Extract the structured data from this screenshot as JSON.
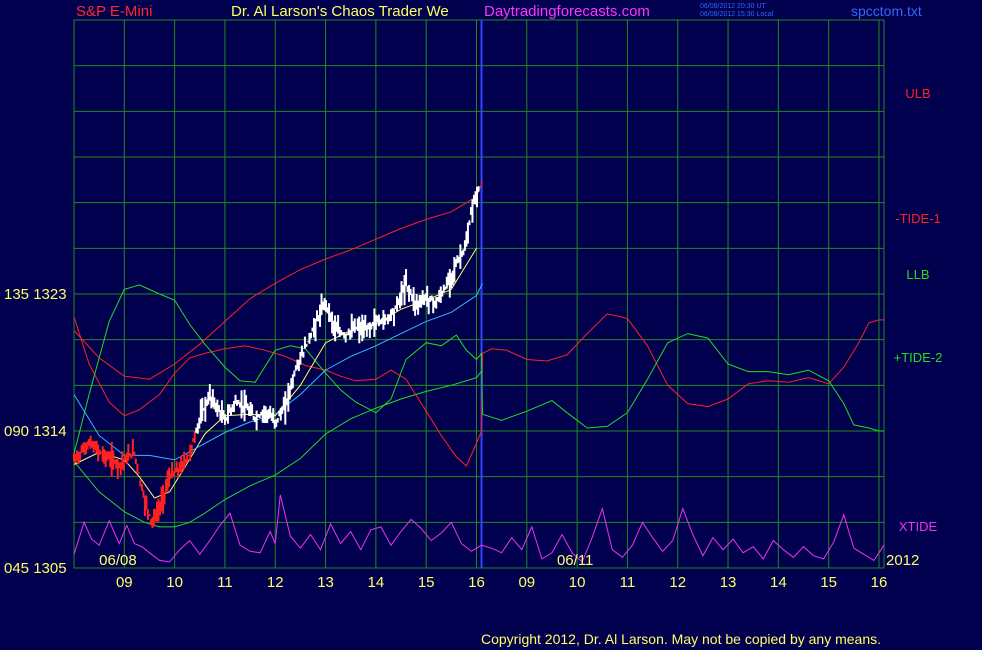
{
  "header": {
    "instrument": "S&P E-Mini",
    "title": "Dr. Al Larson's Chaos Trader We",
    "website": "Daytradingforecasts.com",
    "time_utc": "06/08/2012 20:30 UT",
    "time_local": "06/08/2012 15:30 Local",
    "filename": "spcctom.txt"
  },
  "colors": {
    "background": "#00004e",
    "grid": "#1f8a1f",
    "price": "#ffffff",
    "price_down": "#ff2020",
    "ulb": "#ff2020",
    "tide1": "#ff2020",
    "llb": "#22dd22",
    "tide2": "#22dd22",
    "xtide": "#ee33ee",
    "yellow_ma": "#ffff66",
    "cyan_ma": "#33bbff",
    "divider": "#3344ff",
    "axis_text": "#ffff66"
  },
  "chart_data": {
    "type": "line",
    "title": "S&P E-Mini",
    "y_axis_labels": [
      {
        "code": "135",
        "price": "1323"
      },
      {
        "code": "090",
        "price": "1314"
      },
      {
        "code": "045",
        "price": "1305"
      }
    ],
    "ylim": [
      1305,
      1341
    ],
    "x_day_labels": [
      {
        "label": "06/08",
        "hour": 8.5
      },
      {
        "label": "06/11",
        "hour": 17.6
      }
    ],
    "x_year_label": "2012",
    "x_hour_ticks": [
      "09",
      "10",
      "11",
      "12",
      "13",
      "14",
      "15",
      "16",
      "09",
      "10",
      "11",
      "12",
      "13",
      "14",
      "15",
      "16"
    ],
    "hour_tick_positions": [
      9,
      10,
      11,
      12,
      13,
      14,
      15,
      16,
      17,
      18,
      19,
      20,
      21,
      22,
      23,
      24
    ],
    "xlim": [
      8.0,
      24.1
    ],
    "divider_hour": 16.1,
    "legend": [
      "ULB",
      "-TIDE-1",
      "LLB",
      "+TIDE-2",
      "XTIDE"
    ],
    "series": [
      {
        "name": "Price",
        "color": "#ffffff",
        "x": [
          8.0,
          8.3,
          8.6,
          8.9,
          9.2,
          9.4,
          9.55,
          9.7,
          9.9,
          10.1,
          10.3,
          10.5,
          10.7,
          10.85,
          11.0,
          11.2,
          11.4,
          11.6,
          11.8,
          12.0,
          12.2,
          12.4,
          12.6,
          12.8,
          13.0,
          13.2,
          13.4,
          13.6,
          13.8,
          14.0,
          14.2,
          14.4,
          14.6,
          14.8,
          15.0,
          15.2,
          15.4,
          15.6,
          15.8,
          15.9,
          16.05
        ],
        "y": [
          1312.1,
          1313.2,
          1312.4,
          1311.8,
          1312.6,
          1309.5,
          1308.0,
          1308.9,
          1311.0,
          1311.5,
          1312.5,
          1314.8,
          1316.3,
          1315.5,
          1314.7,
          1315.9,
          1315.6,
          1314.8,
          1315.3,
          1314.6,
          1315.6,
          1318.0,
          1319.5,
          1321.0,
          1322.5,
          1320.6,
          1320.3,
          1320.8,
          1320.6,
          1321.2,
          1321.3,
          1322.1,
          1323.7,
          1322.3,
          1322.8,
          1322.4,
          1323.5,
          1325.0,
          1326.2,
          1328.5,
          1330.0
        ]
      },
      {
        "name": "ULB",
        "color": "#ff2020",
        "x": [
          8.0,
          8.5,
          9.0,
          9.5,
          10.0,
          10.5,
          11.0,
          11.5,
          12.0,
          12.5,
          13.0,
          13.5,
          14.0,
          14.5,
          15.0,
          15.5,
          16.0,
          16.12
        ],
        "y": [
          1320.6,
          1318.8,
          1317.6,
          1317.4,
          1318.4,
          1319.7,
          1321.2,
          1322.7,
          1323.7,
          1324.6,
          1325.3,
          1325.9,
          1326.6,
          1327.3,
          1327.9,
          1328.4,
          1329.4,
          1330.4
        ]
      },
      {
        "name": "LLB",
        "color": "#22dd22",
        "x": [
          8.0,
          8.5,
          9.0,
          9.4,
          9.7,
          10.0,
          10.3,
          10.6,
          11.0,
          11.5,
          12.0,
          12.5,
          13.0,
          13.5,
          14.0,
          14.5,
          15.0,
          15.5,
          16.0,
          16.12
        ],
        "y": [
          1312.0,
          1310.0,
          1308.7,
          1308.0,
          1307.7,
          1307.7,
          1308.0,
          1308.6,
          1309.5,
          1310.4,
          1311.1,
          1312.2,
          1313.8,
          1314.8,
          1315.5,
          1316.1,
          1316.6,
          1317.0,
          1317.5,
          1318.0
        ]
      },
      {
        "name": "-TIDE-1",
        "color": "#ff2020",
        "x": [
          8.0,
          8.3,
          8.7,
          9.0,
          9.3,
          9.7,
          10.0,
          10.3,
          10.6,
          11.0,
          11.4,
          11.8,
          12.2,
          12.6,
          13.0,
          13.3,
          13.6,
          14.0,
          14.3,
          14.6,
          15.0,
          15.3,
          15.6,
          15.8,
          16.0,
          16.1,
          16.12,
          16.3,
          16.6,
          17.0,
          17.4,
          17.8,
          18.2,
          18.6,
          19.0,
          19.4,
          19.8,
          20.2,
          20.6,
          21.0,
          21.4,
          21.8,
          22.2,
          22.6,
          23.0,
          23.3,
          23.6,
          23.8,
          24.0,
          24.1
        ],
        "y": [
          1321.5,
          1318.4,
          1315.9,
          1315.0,
          1315.4,
          1316.4,
          1317.8,
          1318.8,
          1319.1,
          1319.4,
          1319.6,
          1319.3,
          1318.9,
          1318.3,
          1318.0,
          1317.6,
          1317.3,
          1317.4,
          1318.0,
          1317.4,
          1315.3,
          1313.7,
          1312.3,
          1311.7,
          1313.2,
          1314.0,
          1319.1,
          1319.4,
          1319.3,
          1318.7,
          1318.6,
          1319.0,
          1320.4,
          1321.7,
          1321.4,
          1319.6,
          1317.0,
          1315.8,
          1315.6,
          1316.1,
          1317.1,
          1317.3,
          1317.2,
          1317.5,
          1317.1,
          1318.2,
          1319.8,
          1321.1,
          1321.3,
          1321.3
        ]
      },
      {
        "name": "+TIDE-2",
        "color": "#22dd22",
        "x": [
          8.0,
          8.3,
          8.7,
          9.0,
          9.3,
          9.7,
          10.0,
          10.3,
          10.6,
          11.0,
          11.3,
          11.6,
          12.0,
          12.3,
          12.6,
          13.0,
          13.3,
          13.6,
          14.0,
          14.3,
          14.6,
          15.0,
          15.3,
          15.6,
          15.8,
          16.0,
          16.1,
          16.12,
          16.5,
          17.0,
          17.5,
          17.8,
          18.2,
          18.6,
          19.0,
          19.4,
          19.8,
          20.2,
          20.6,
          21.0,
          21.4,
          21.8,
          22.2,
          22.6,
          23.0,
          23.3,
          23.5,
          23.8,
          24.0,
          24.1
        ],
        "y": [
          1312.5,
          1316.4,
          1321.2,
          1323.3,
          1323.6,
          1323.0,
          1322.6,
          1321.0,
          1319.7,
          1318.2,
          1317.3,
          1317.2,
          1319.3,
          1319.6,
          1319.4,
          1317.8,
          1316.7,
          1315.9,
          1315.2,
          1316.1,
          1318.7,
          1319.8,
          1319.6,
          1320.3,
          1319.3,
          1318.7,
          1319.1,
          1315.1,
          1314.7,
          1315.3,
          1316.0,
          1315.2,
          1314.2,
          1314.3,
          1315.2,
          1317.4,
          1319.8,
          1320.4,
          1320.1,
          1318.4,
          1317.9,
          1317.9,
          1317.7,
          1318.0,
          1317.3,
          1315.8,
          1314.4,
          1314.2,
          1314.0,
          1314.0
        ]
      },
      {
        "name": "XTIDE",
        "color": "#ee33ee",
        "x": [
          8.0,
          8.2,
          8.35,
          8.5,
          8.7,
          8.9,
          9.05,
          9.2,
          9.35,
          9.5,
          9.7,
          9.9,
          10.1,
          10.3,
          10.5,
          10.7,
          10.9,
          11.1,
          11.3,
          11.5,
          11.7,
          11.9,
          12.0,
          12.1,
          12.3,
          12.5,
          12.7,
          12.9,
          13.1,
          13.3,
          13.5,
          13.7,
          13.9,
          14.1,
          14.3,
          14.5,
          14.7,
          14.9,
          15.1,
          15.3,
          15.5,
          15.7,
          15.9,
          16.1,
          16.3,
          16.5,
          16.7,
          16.9,
          17.1,
          17.3,
          17.5,
          17.7,
          17.9,
          18.1,
          18.3,
          18.5,
          18.7,
          18.9,
          19.1,
          19.3,
          19.5,
          19.7,
          19.9,
          20.1,
          20.3,
          20.5,
          20.7,
          20.9,
          21.1,
          21.3,
          21.5,
          21.7,
          21.9,
          22.1,
          22.3,
          22.5,
          22.7,
          22.9,
          23.1,
          23.3,
          23.5,
          23.7,
          23.9,
          24.1
        ],
        "y": [
          1305.9,
          1308.0,
          1306.9,
          1306.5,
          1308.1,
          1306.6,
          1307.8,
          1306.6,
          1306.4,
          1306.0,
          1305.5,
          1305.4,
          1306.2,
          1306.8,
          1305.9,
          1306.8,
          1307.8,
          1308.6,
          1306.5,
          1306.1,
          1306.0,
          1307.4,
          1306.6,
          1309.8,
          1307.1,
          1306.3,
          1307.2,
          1306.2,
          1307.9,
          1306.6,
          1307.4,
          1306.2,
          1307.5,
          1307.7,
          1306.5,
          1307.4,
          1308.2,
          1307.6,
          1306.8,
          1307.3,
          1308.0,
          1306.6,
          1306.1,
          1306.5,
          1306.3,
          1306.0,
          1307.0,
          1306.2,
          1307.7,
          1305.6,
          1306.0,
          1307.2,
          1306.0,
          1305.4,
          1307.0,
          1308.9,
          1306.2,
          1305.7,
          1306.5,
          1308.0,
          1307.0,
          1306.1,
          1306.8,
          1308.9,
          1307.2,
          1305.8,
          1307.0,
          1306.2,
          1306.9,
          1306.0,
          1306.4,
          1305.6,
          1306.8,
          1306.2,
          1305.7,
          1306.4,
          1305.8,
          1305.6,
          1306.7,
          1308.5,
          1306.3,
          1305.9,
          1305.5,
          1306.5
        ]
      },
      {
        "name": "MA fast",
        "color": "#ffff66",
        "x": [
          8.0,
          8.5,
          9.0,
          9.3,
          9.6,
          9.9,
          10.2,
          10.6,
          11.0,
          11.5,
          12.0,
          12.5,
          13.0,
          13.5,
          14.0,
          14.5,
          15.0,
          15.5,
          16.0
        ],
        "y": [
          1311.8,
          1312.6,
          1312.1,
          1311.0,
          1309.6,
          1310.0,
          1311.6,
          1313.8,
          1315.0,
          1315.1,
          1315.0,
          1317.0,
          1319.8,
          1320.6,
          1321.0,
          1322.0,
          1322.6,
          1323.3,
          1326.0
        ]
      },
      {
        "name": "MA slow",
        "color": "#33bbff",
        "x": [
          8.0,
          8.5,
          9.0,
          9.5,
          10.0,
          10.5,
          11.0,
          11.5,
          12.0,
          12.5,
          13.0,
          13.5,
          14.0,
          14.5,
          15.0,
          15.5,
          16.0,
          16.12
        ],
        "y": [
          1316.4,
          1313.7,
          1312.4,
          1312.4,
          1312.1,
          1313.0,
          1313.9,
          1314.6,
          1315.1,
          1316.4,
          1318.0,
          1318.9,
          1319.6,
          1320.4,
          1321.2,
          1321.8,
          1322.9,
          1323.7
        ]
      }
    ]
  },
  "footer": {
    "copyright": "Copyright 2012, Dr. Al Larson. May not be copied by any means."
  }
}
